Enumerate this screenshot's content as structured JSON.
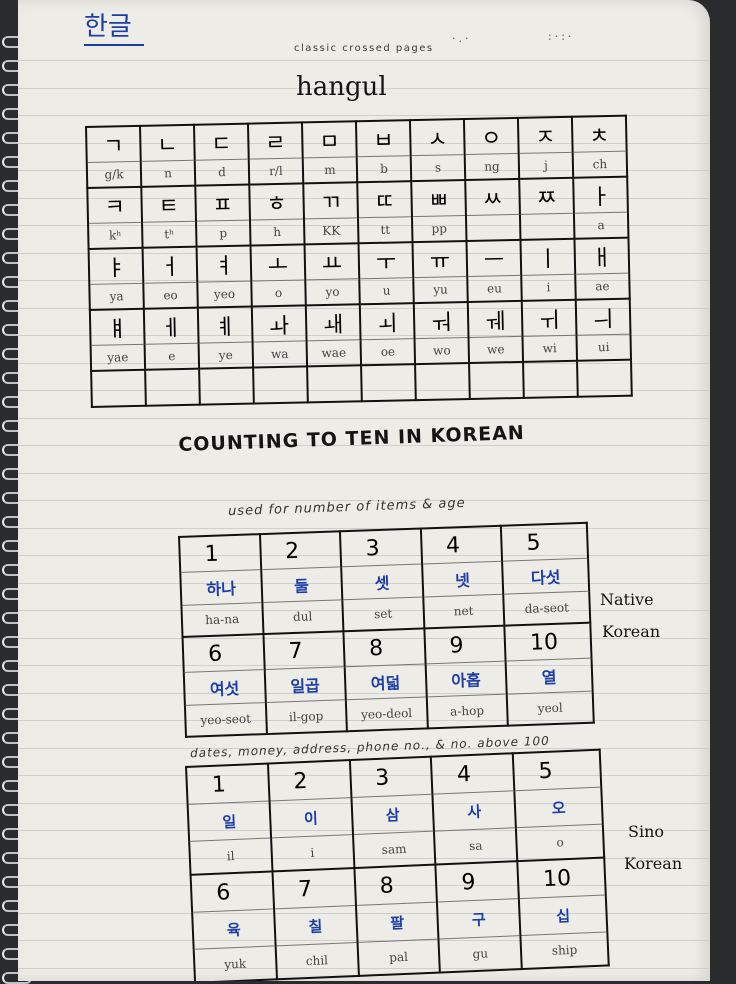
{
  "header": {
    "korean": "한글",
    "label": "classic crossed pages"
  },
  "title": "hangul",
  "hangul_rows": [
    {
      "glyphs": [
        "ㄱ",
        "ㄴ",
        "ㄷ",
        "ㄹ",
        "ㅁ",
        "ㅂ",
        "ㅅ",
        "ㅇ",
        "ㅈ",
        "ㅊ"
      ],
      "roman": [
        "g/k",
        "n",
        "d",
        "r/l",
        "m",
        "b",
        "s",
        "ng",
        "j",
        "ch"
      ]
    },
    {
      "glyphs": [
        "ㅋ",
        "ㅌ",
        "ㅍ",
        "ㅎ",
        "ㄲ",
        "ㄸ",
        "ㅃ",
        "ㅆ",
        "ㅉ",
        "ㅏ"
      ],
      "roman": [
        "kʰ",
        "tʰ",
        "p",
        "h",
        "KK",
        "tt",
        "pp",
        "",
        "",
        "a"
      ]
    },
    {
      "glyphs": [
        "ㅑ",
        "ㅓ",
        "ㅕ",
        "ㅗ",
        "ㅛ",
        "ㅜ",
        "ㅠ",
        "ㅡ",
        "ㅣ",
        "ㅐ"
      ],
      "roman": [
        "ya",
        "eo",
        "yeo",
        "o",
        "yo",
        "u",
        "yu",
        "eu",
        "i",
        "ae"
      ]
    },
    {
      "glyphs": [
        "ㅒ",
        "ㅔ",
        "ㅖ",
        "ㅘ",
        "ㅙ",
        "ㅚ",
        "ㅝ",
        "ㅞ",
        "ㅟ",
        "ㅢ"
      ],
      "roman": [
        "yae",
        "e",
        "ye",
        "wa",
        "wae",
        "oe",
        "wo",
        "we",
        "wi",
        "ui"
      ]
    }
  ],
  "counting_heading": "COUNTING TO TEN IN KOREAN",
  "native": {
    "note": "used for number of items & age",
    "side_label": [
      "Native",
      "Korean"
    ],
    "rows": [
      {
        "nums": [
          "1",
          "2",
          "3",
          "4",
          "5"
        ],
        "korean": [
          "하나",
          "둘",
          "셋",
          "넷",
          "다섯"
        ],
        "roman": [
          "ha-na",
          "dul",
          "set",
          "net",
          "da-seot"
        ]
      },
      {
        "nums": [
          "6",
          "7",
          "8",
          "9",
          "10"
        ],
        "korean": [
          "여섯",
          "일곱",
          "여덟",
          "아홉",
          "열"
        ],
        "roman": [
          "yeo-seot",
          "il-gop",
          "yeo-deol",
          "a-hop",
          "yeol"
        ]
      }
    ]
  },
  "sino": {
    "note": "dates, money, address, phone no., & no. above 100",
    "side_label": [
      "Sino",
      "Korean"
    ],
    "rows": [
      {
        "nums": [
          "1",
          "2",
          "3",
          "4",
          "5"
        ],
        "korean": [
          "일",
          "이",
          "삼",
          "사",
          "오"
        ],
        "roman": [
          "il",
          "i",
          "sam",
          "sa",
          "o"
        ]
      },
      {
        "nums": [
          "6",
          "7",
          "8",
          "9",
          "10"
        ],
        "korean": [
          "육",
          "칠",
          "팔",
          "구",
          "십"
        ],
        "roman": [
          "yuk",
          "chil",
          "pal",
          "gu",
          "ship"
        ]
      }
    ]
  }
}
